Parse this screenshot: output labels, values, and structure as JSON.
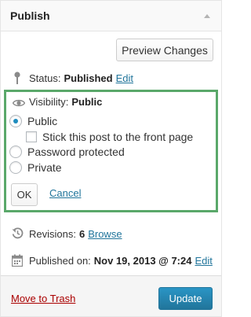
{
  "box": {
    "title": "Publish",
    "toggle_icon": "triangle-up-icon"
  },
  "actions": {
    "preview_label": "Preview Changes"
  },
  "status": {
    "icon": "pin-icon",
    "label": "Status:",
    "value": "Published",
    "edit_label": "Edit"
  },
  "visibility": {
    "icon": "eye-icon",
    "label": "Visibility:",
    "value": "Public",
    "options": [
      {
        "label": "Public",
        "checked": true
      },
      {
        "label": "Password protected",
        "checked": false
      },
      {
        "label": "Private",
        "checked": false
      }
    ],
    "sticky_label": "Stick this post to the front page",
    "sticky_checked": false,
    "ok_label": "OK",
    "cancel_label": "Cancel",
    "highlight_color": "#5aa86a"
  },
  "revisions": {
    "icon": "revisions-icon",
    "label": "Revisions:",
    "count": "6",
    "browse_label": "Browse"
  },
  "published": {
    "icon": "calendar-icon",
    "label": "Published on:",
    "date": "Nov 19, 2013 @ 7:24",
    "edit_label": "Edit"
  },
  "footer": {
    "trash_label": "Move to Trash",
    "update_label": "Update"
  }
}
